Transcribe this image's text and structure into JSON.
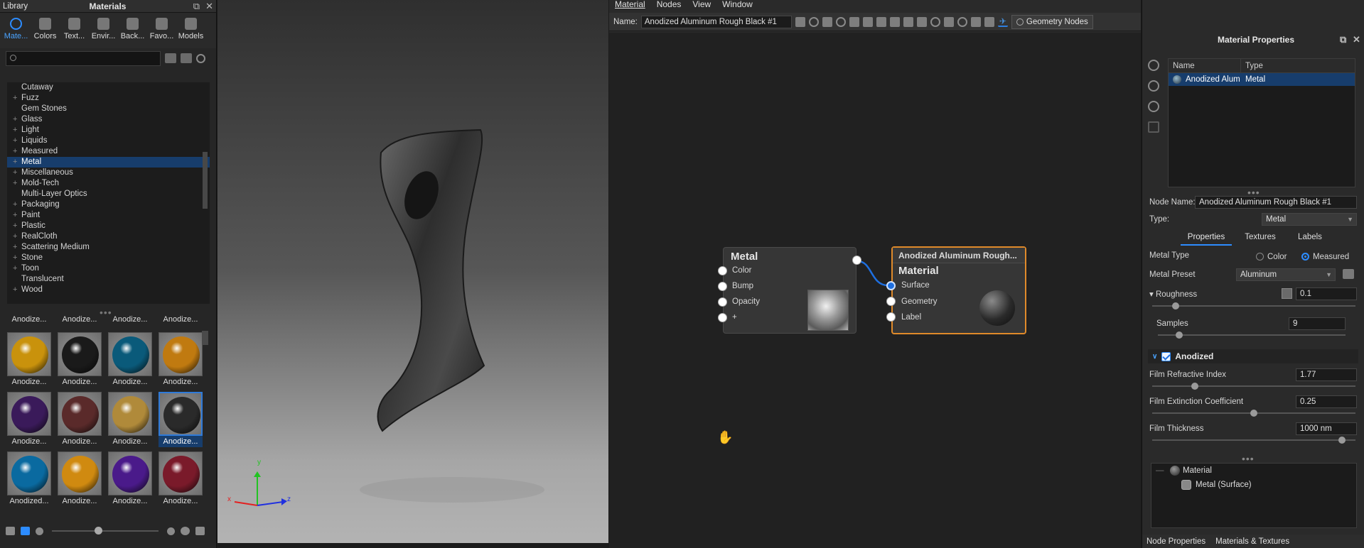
{
  "library": {
    "title_left": "Library",
    "title_center": "Materials",
    "tabs": [
      {
        "label": "Mate...",
        "icon": "search-icon"
      },
      {
        "label": "Colors",
        "icon": "droplet-icon"
      },
      {
        "label": "Text...",
        "icon": "texture-icon"
      },
      {
        "label": "Envir...",
        "icon": "globe-icon"
      },
      {
        "label": "Back...",
        "icon": "image-icon"
      },
      {
        "label": "Favo...",
        "icon": "star-icon"
      },
      {
        "label": "Models",
        "icon": "models-icon"
      }
    ],
    "search_placeholder": "",
    "tree": [
      {
        "label": "Cutaway",
        "expandable": false
      },
      {
        "label": "Fuzz",
        "expandable": true
      },
      {
        "label": "Gem Stones",
        "expandable": false
      },
      {
        "label": "Glass",
        "expandable": true
      },
      {
        "label": "Light",
        "expandable": true
      },
      {
        "label": "Liquids",
        "expandable": true
      },
      {
        "label": "Measured",
        "expandable": true
      },
      {
        "label": "Metal",
        "expandable": true,
        "selected": true
      },
      {
        "label": "Miscellaneous",
        "expandable": true
      },
      {
        "label": "Mold-Tech",
        "expandable": true
      },
      {
        "label": "Multi-Layer Optics",
        "expandable": false
      },
      {
        "label": "Packaging",
        "expandable": true
      },
      {
        "label": "Paint",
        "expandable": true
      },
      {
        "label": "Plastic",
        "expandable": true
      },
      {
        "label": "RealCloth",
        "expandable": true
      },
      {
        "label": "Scattering Medium",
        "expandable": true
      },
      {
        "label": "Stone",
        "expandable": true
      },
      {
        "label": "Toon",
        "expandable": true
      },
      {
        "label": "Translucent",
        "expandable": false
      },
      {
        "label": "Wood",
        "expandable": true
      }
    ],
    "swatches": [
      {
        "label": "Anodize...",
        "color": "#7a6a55"
      },
      {
        "label": "Anodize...",
        "color": "#7a6a55"
      },
      {
        "label": "Anodize...",
        "color": "#7a6a55"
      },
      {
        "label": "Anodize...",
        "color": "#7a6a55"
      },
      {
        "label": "Anodize...",
        "color": "#c9920c"
      },
      {
        "label": "Anodize...",
        "color": "#1a1a1a"
      },
      {
        "label": "Anodize...",
        "color": "#0a5a7a"
      },
      {
        "label": "Anodize...",
        "color": "#c07a10"
      },
      {
        "label": "Anodize...",
        "color": "#3a1a5a"
      },
      {
        "label": "Anodize...",
        "color": "#5a2a2a"
      },
      {
        "label": "Anodize...",
        "color": "#b08a3a"
      },
      {
        "label": "Anodize...",
        "color": "#2a2a2a",
        "selected": true
      },
      {
        "label": "Anodized...",
        "color": "#0a6aa0"
      },
      {
        "label": "Anodize...",
        "color": "#d08a10"
      },
      {
        "label": "Anodize...",
        "color": "#4a1a8a"
      },
      {
        "label": "Anodize...",
        "color": "#7a1a2a"
      }
    ]
  },
  "viewport": {
    "axes": {
      "x": "x",
      "y": "y",
      "z": "z"
    }
  },
  "node_editor": {
    "menu": [
      "Material",
      "Nodes",
      "View",
      "Window"
    ],
    "name_label": "Name:",
    "name_value": "Anodized Aluminum Rough Black #1",
    "geometry_nodes_label": "Geometry Nodes",
    "metal_node": {
      "title": "Metal",
      "ports": [
        "Color",
        "Bump",
        "Opacity",
        "+"
      ]
    },
    "material_node": {
      "header": "Anodized Aluminum Rough...",
      "title": "Material",
      "ports": [
        "Surface",
        "Geometry",
        "Label"
      ]
    }
  },
  "material_properties": {
    "title": "Material Properties",
    "table_headers": [
      "Name",
      "Type"
    ],
    "table_row": {
      "name": "Anodized Alum",
      "type": "Metal"
    },
    "node_name_label": "Node Name:",
    "node_name_value": "Anodized Aluminum Rough Black #1",
    "type_label": "Type:",
    "type_value": "Metal",
    "subtabs": [
      "Properties",
      "Textures",
      "Labels"
    ],
    "metal_type_label": "Metal Type",
    "metal_type_options": [
      "Color",
      "Measured"
    ],
    "metal_type_selected": "Measured",
    "metal_preset_label": "Metal Preset",
    "metal_preset_value": "Aluminum",
    "roughness_label": "Roughness",
    "roughness_value": "0.1",
    "roughness_level": 0.1,
    "samples_label": "Samples",
    "samples_value": "9",
    "samples_level": 0.1,
    "anodized_label": "Anodized",
    "film_ri_label": "Film Refractive Index",
    "film_ri_value": "1.77",
    "film_ri_level": 0.2,
    "film_ec_label": "Film Extinction Coefficient",
    "film_ec_value": "0.25",
    "film_ec_level": 0.5,
    "film_th_label": "Film Thickness",
    "film_th_value": "1000 nm",
    "film_th_level": 0.95,
    "tree": [
      {
        "label": "Material",
        "icon": "sphere-icon"
      },
      {
        "label": "Metal (Surface)",
        "icon": "metal-icon"
      }
    ],
    "bottom_tabs": [
      "Node Properties",
      "Materials & Textures"
    ]
  }
}
